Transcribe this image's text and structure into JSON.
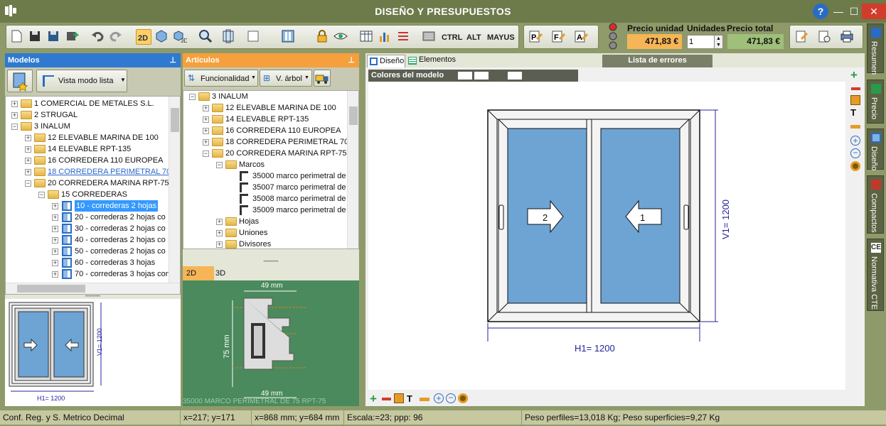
{
  "window": {
    "title": "DISEÑO Y PRESUPUESTOS",
    "help": "?",
    "minimize": "—",
    "maximize": "☐",
    "close": "✕"
  },
  "toolbar": {
    "modifiers": [
      "CTRL",
      "ALT",
      "MAYUS"
    ],
    "precio_unidad_label": "Precio unidad",
    "precio_unidad": "471,83 €",
    "unidades_label": "Unidades",
    "unidades": "1",
    "precio_total_label": "Precio total",
    "precio_total": "471,83 €"
  },
  "modelos": {
    "title": "Modelos",
    "view_button": "Vista modo lista",
    "tree": [
      {
        "label": "1 COMERCIAL DE METALES S.L.",
        "level": 0,
        "sign": "+"
      },
      {
        "label": "2 STRUGAL",
        "level": 0,
        "sign": "+"
      },
      {
        "label": "3 INALUM",
        "level": 0,
        "sign": "−"
      },
      {
        "label": "12 ELEVABLE MARINA DE 100",
        "level": 1,
        "sign": "+"
      },
      {
        "label": "14 ELEVABLE RPT-135",
        "level": 1,
        "sign": "+"
      },
      {
        "label": "16 CORREDERA 110 EUROPEA",
        "level": 1,
        "sign": "+"
      },
      {
        "label": "18 CORREDERA PERIMETRAL 70",
        "level": 1,
        "sign": "+",
        "link": true
      },
      {
        "label": "20 CORREDERA MARINA RPT-75",
        "level": 1,
        "sign": "−"
      },
      {
        "label": "15 CORREDERAS",
        "level": 2,
        "sign": "−"
      },
      {
        "label": "10 - correderas 2 hojas",
        "level": 3,
        "sign": "+",
        "selected": true
      },
      {
        "label": "20 - correderas 2 hojas co",
        "level": 3,
        "sign": "+"
      },
      {
        "label": "30 - correderas 2 hojas co",
        "level": 3,
        "sign": "+"
      },
      {
        "label": "40 - correderas 2 hojas co",
        "level": 3,
        "sign": "+"
      },
      {
        "label": "50 - correderas 2 hojas co",
        "level": 3,
        "sign": "+"
      },
      {
        "label": "60 - correderas 3 hojas",
        "level": 3,
        "sign": "+"
      },
      {
        "label": "70 - correderas 3 hojas con",
        "level": 3,
        "sign": "+"
      }
    ],
    "preview_h": "H1= 1200",
    "preview_v": "V1= 1200"
  },
  "articulos": {
    "title": "Artículos",
    "func_button": "Funcionalidad",
    "tree_button": "V. árbol",
    "tree": [
      {
        "label": "3 INALUM",
        "level": 0,
        "sign": "−"
      },
      {
        "label": "12 ELEVABLE MARINA DE 100",
        "level": 1,
        "sign": "+"
      },
      {
        "label": "14 ELEVABLE RPT-135",
        "level": 1,
        "sign": "+"
      },
      {
        "label": "16 CORREDERA 110 EUROPEA",
        "level": 1,
        "sign": "+"
      },
      {
        "label": "18 CORREDERA PERIMETRAL 70",
        "level": 1,
        "sign": "+"
      },
      {
        "label": "20 CORREDERA MARINA RPT-75",
        "level": 1,
        "sign": "−"
      },
      {
        "label": "Marcos",
        "level": 2,
        "sign": "−"
      },
      {
        "label": "35000 marco perimetral de",
        "level": 3,
        "item": true
      },
      {
        "label": "35007 marco perimetral de",
        "level": 3,
        "item": true
      },
      {
        "label": "35008 marco perimetral de",
        "level": 3,
        "item": true
      },
      {
        "label": "35009 marco perimetral de",
        "level": 3,
        "item": true
      },
      {
        "label": "Hojas",
        "level": 2,
        "sign": "+"
      },
      {
        "label": "Uniones",
        "level": 2,
        "sign": "+"
      },
      {
        "label": "Divisores",
        "level": 2,
        "sign": "+"
      }
    ],
    "tabs": [
      "2D",
      "3D"
    ],
    "profile_width": "49 mm",
    "profile_height": "75 mm",
    "profile_caption": "35000 MARCO PERIMETRAL DE 75 RPT-75"
  },
  "design": {
    "tabs": [
      "Diseño",
      "Elementos"
    ],
    "errors_title": "Lista de errores",
    "colors_label": "Colores del modelo",
    "leaf_left": "2",
    "leaf_right": "1",
    "h_dim": "H1= 1200",
    "v_dim": "V1= 1200"
  },
  "side_tabs": [
    "Resumen",
    "Precio",
    "Diseño",
    "Compactos",
    "Normativa CTE"
  ],
  "status": {
    "config": "Conf. Reg. y S. Metrico Decimal",
    "xy": "x=217; y=171",
    "xy_mm": "x=868 mm; y=684 mm",
    "scale": "Escala:=23; ppp: 96",
    "weights": "Peso perfiles=13,018 Kg; Peso superficies=9,27 Kg"
  },
  "colors": {
    "glass": "#6ea4d4",
    "panel_header": "#4b8fd6",
    "articulos_header": "#f5a03c",
    "profile_bg": "#4a8a5c"
  }
}
